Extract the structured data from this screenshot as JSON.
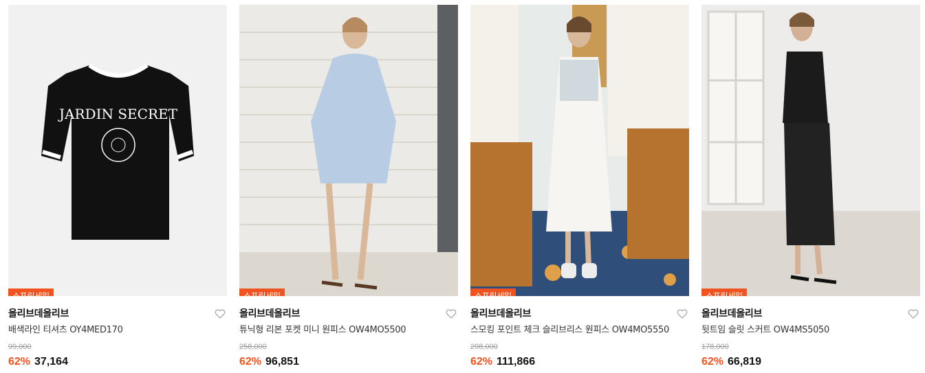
{
  "products": [
    {
      "badge": "스프링세일",
      "brand": "올리브데올리브",
      "name": "배색라인 티셔츠 OY4MED170",
      "original_price": "99,000",
      "discount": "62%",
      "price": "37,164",
      "image_icon": "black-tshirt-image"
    },
    {
      "badge": "스프링세일",
      "brand": "올리브데올리브",
      "name": "튜닉형 리본 포켓 미니 원피스 OW4MO5500",
      "original_price": "258,000",
      "discount": "62%",
      "price": "96,851",
      "image_icon": "blue-mini-dress-image"
    },
    {
      "badge": "스프링세일",
      "brand": "올리브데올리브",
      "name": "스모킹 포인트 체크 슬리브리스 원피스 OW4MO5550",
      "original_price": "298,000",
      "discount": "62%",
      "price": "111,866",
      "image_icon": "white-smocked-dress-image"
    },
    {
      "badge": "스프링세일",
      "brand": "올리브데올리브",
      "name": "뒷트임 슬릿 스커트 OW4MS5050",
      "original_price": "178,000",
      "discount": "62%",
      "price": "66,819",
      "image_icon": "black-skirt-image"
    }
  ],
  "colors": {
    "accent": "#f0531f",
    "strike": "#9a9a9a"
  }
}
